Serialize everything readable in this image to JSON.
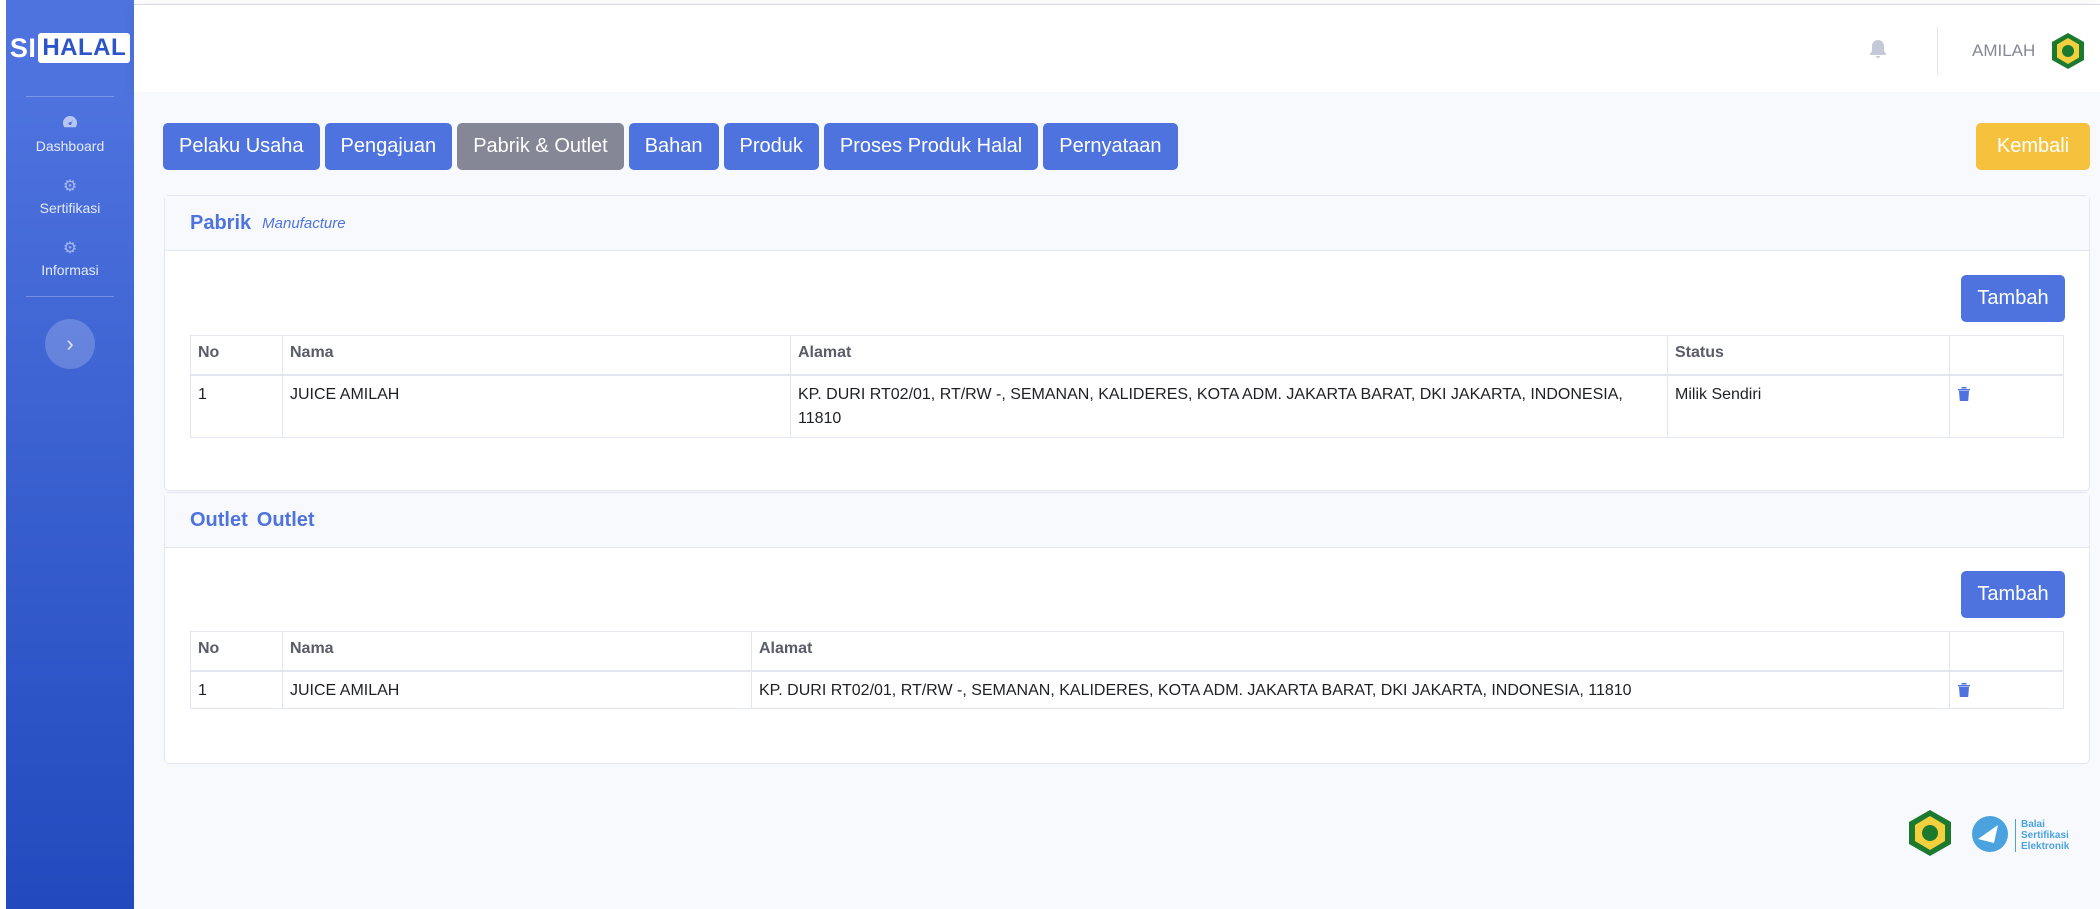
{
  "brand": {
    "part1": "SI",
    "part2": "HALAL"
  },
  "sidebar": {
    "items": [
      {
        "label": "Dashboard",
        "icon": "tachometer-icon"
      },
      {
        "label": "Sertifikasi",
        "icon": "gear-icon"
      },
      {
        "label": "Informasi",
        "icon": "gear-icon"
      }
    ],
    "toggle_icon": "chevron-right-icon"
  },
  "topbar": {
    "user_name": "AMILAH"
  },
  "tabs": [
    {
      "label": "Pelaku Usaha",
      "active": false
    },
    {
      "label": "Pengajuan",
      "active": false
    },
    {
      "label": "Pabrik & Outlet",
      "active": true
    },
    {
      "label": "Bahan",
      "active": false
    },
    {
      "label": "Produk",
      "active": false
    },
    {
      "label": "Proses Produk Halal",
      "active": false
    },
    {
      "label": "Pernyataan",
      "active": false
    }
  ],
  "back_label": "Kembali",
  "pabrik": {
    "title": "Pabrik",
    "subtitle": "Manufacture",
    "add_label": "Tambah",
    "columns": [
      "No",
      "Nama",
      "Alamat",
      "Status",
      ""
    ],
    "rows": [
      {
        "no": "1",
        "nama": "JUICE AMILAH",
        "alamat": "KP. DURI RT02/01, RT/RW -, SEMANAN, KALIDERES, KOTA ADM. JAKARTA BARAT, DKI JAKARTA, INDONESIA, 11810",
        "status": "Milik Sendiri"
      }
    ]
  },
  "outlet": {
    "title": "Outlet",
    "subtitle": "Outlet",
    "add_label": "Tambah",
    "columns": [
      "No",
      "Nama",
      "Alamat",
      ""
    ],
    "rows": [
      {
        "no": "1",
        "nama": "JUICE AMILAH",
        "alamat": "KP. DURI RT02/01, RT/RW -, SEMANAN, KALIDERES, KOTA ADM. JAKARTA BARAT, DKI JAKARTA, INDONESIA, 11810"
      }
    ]
  },
  "footer": {
    "bse_lines": [
      "Balai",
      "Sertifikasi",
      "Elektronik"
    ]
  },
  "colors": {
    "primary": "#4e73df",
    "secondary": "#858796",
    "warning": "#f6c23e"
  }
}
